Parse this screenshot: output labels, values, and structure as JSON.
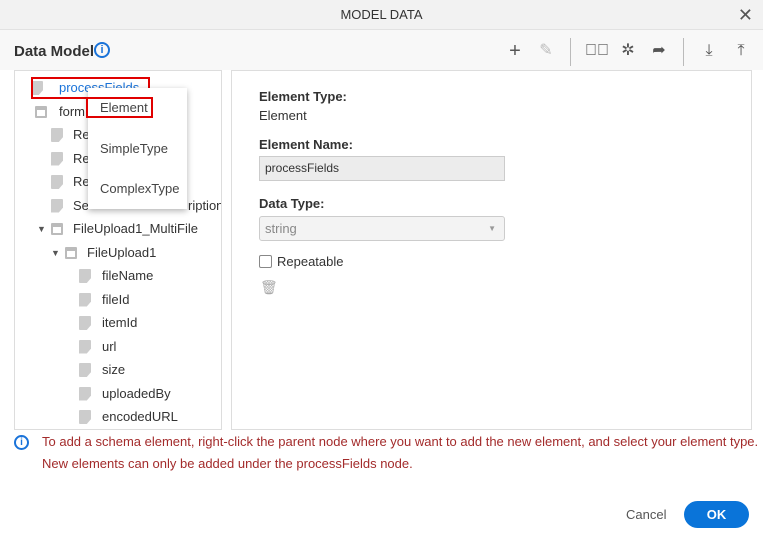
{
  "dialog": {
    "title": "MODEL DATA",
    "close_icon": "close-icon"
  },
  "header": {
    "title": "Data Model",
    "info_icon": "info-icon"
  },
  "toolbar": [
    "add-icon",
    "edit-icon",
    "validate-icon",
    "bug-icon",
    "share-icon",
    "download-icon",
    "upload-icon"
  ],
  "tree": [
    {
      "label": "processFields",
      "level": 0,
      "kind": "leaf",
      "selected": true
    },
    {
      "label": "form",
      "level": 0,
      "kind": "group",
      "expanded": true
    },
    {
      "label": "Re",
      "level": 1,
      "kind": "leaf"
    },
    {
      "label": "Re",
      "level": 1,
      "kind": "leaf"
    },
    {
      "label": "Re",
      "level": 1,
      "kind": "leaf"
    },
    {
      "label": "Se",
      "tail": "ription",
      "level": 1,
      "kind": "leaf"
    },
    {
      "label": "FileUpload1_MultiFile",
      "level": 1,
      "kind": "group",
      "expanded": true
    },
    {
      "label": "FileUpload1",
      "level": 2,
      "kind": "group",
      "expanded": true
    },
    {
      "label": "fileName",
      "level": 3,
      "kind": "leaf"
    },
    {
      "label": "fileId",
      "level": 3,
      "kind": "leaf"
    },
    {
      "label": "itemId",
      "level": 3,
      "kind": "leaf"
    },
    {
      "label": "url",
      "level": 3,
      "kind": "leaf"
    },
    {
      "label": "size",
      "level": 3,
      "kind": "leaf"
    },
    {
      "label": "uploadedBy",
      "level": 3,
      "kind": "leaf"
    },
    {
      "label": "encodedURL",
      "level": 3,
      "kind": "leaf"
    }
  ],
  "context_menu": {
    "items": [
      "Element",
      "SimpleType",
      "ComplexType"
    ],
    "highlighted": "Element"
  },
  "details": {
    "element_type_label": "Element Type:",
    "element_type": "Element",
    "element_name_label": "Element Name:",
    "element_name": "processFields",
    "data_type_label": "Data Type:",
    "data_type": "string",
    "repeatable_label": "Repeatable",
    "repeatable": false
  },
  "note": {
    "line1": "To add a schema element, right-click the parent node where you want to add the new element, and select your element type.",
    "line2": "New elements can only be added under the processFields node."
  },
  "footer": {
    "cancel": "Cancel",
    "ok": "OK"
  },
  "colors": {
    "accent": "#0a74d9",
    "note": "#a32b2b",
    "highlight": "#e00000"
  }
}
